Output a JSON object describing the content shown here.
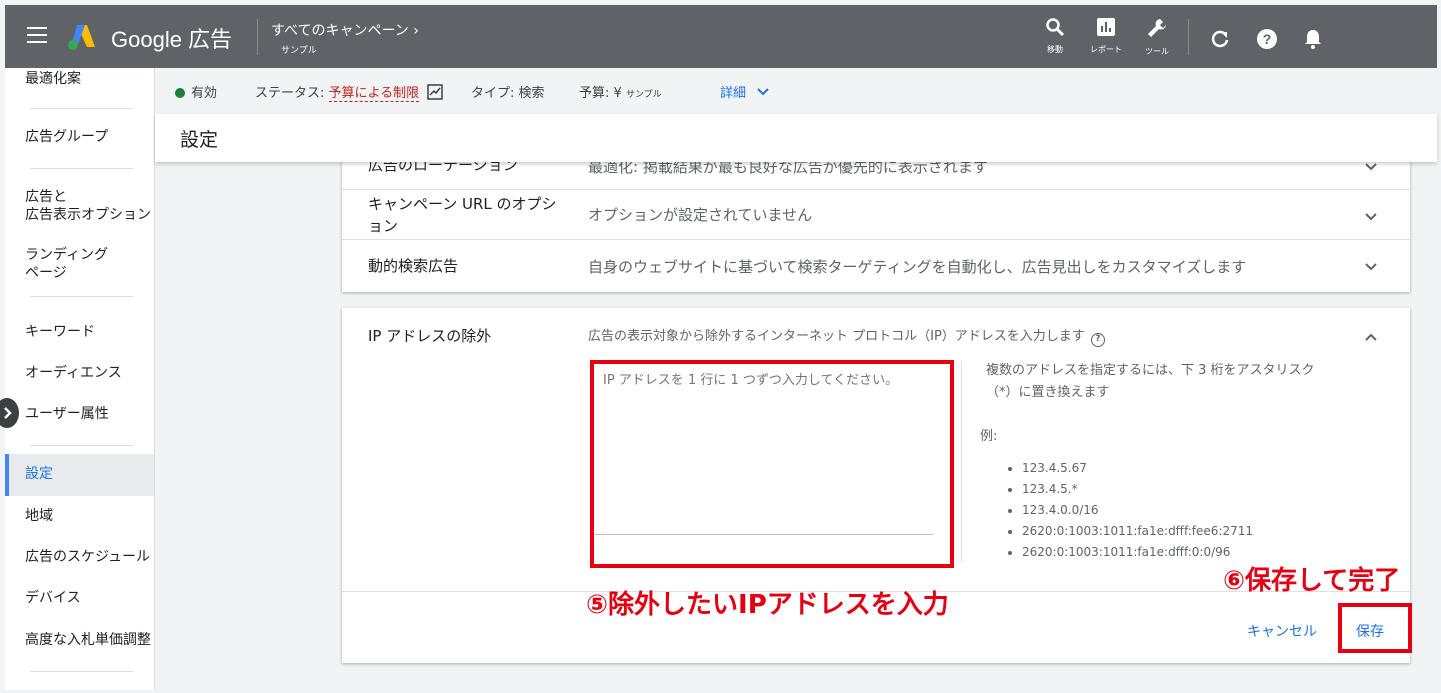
{
  "topbar": {
    "menu_icon": "hamburger-icon",
    "logo_text": "Google 広告",
    "crumb_title": "すべてのキャンペーン",
    "crumb_sub": "サンプル",
    "actions": [
      {
        "icon": "search-icon",
        "label": "移動"
      },
      {
        "icon": "report-icon",
        "label": "レポート"
      },
      {
        "icon": "wrench-icon",
        "label": "ツール"
      }
    ],
    "refresh_icon": "refresh-icon",
    "help_icon": "help-icon",
    "bell_icon": "bell-icon"
  },
  "sidebar": {
    "items": [
      {
        "label": "最適化案"
      },
      {
        "label": "広告グループ"
      },
      {
        "label": "広告と\n広告表示オプション"
      },
      {
        "label": "ランディング\nページ"
      },
      {
        "label": "キーワード"
      },
      {
        "label": "オーディエンス"
      },
      {
        "label": "ユーザー属性"
      },
      {
        "label": "設定"
      },
      {
        "label": "地域"
      },
      {
        "label": "広告のスケジュール"
      },
      {
        "label": "デバイス"
      },
      {
        "label": "高度な入札単価調整"
      }
    ],
    "active_index": 7
  },
  "status": {
    "enabled_label": "有効",
    "status_prefix": "ステータス:",
    "status_value": "予算による制限",
    "type_prefix": "タイプ:",
    "type_value": "検索",
    "budget_prefix": "予算: ¥",
    "budget_value": "サンプル",
    "details_label": "詳細"
  },
  "settings": {
    "title": "設定"
  },
  "card1": {
    "rows": [
      {
        "label": "広告のローテーション",
        "value": "最適化: 掲載結果が最も良好な広告が優先的に表示されます"
      },
      {
        "label": "キャンペーン URL のオプション",
        "value": "オプションが設定されていません"
      },
      {
        "label": "動的検索広告",
        "value": "自身のウェブサイトに基づいて検索ターゲティングを自動化し、広告見出しをカスタマイズします"
      }
    ]
  },
  "ip_section": {
    "label": "IP アドレスの除外",
    "description": "広告の表示対象から除外するインターネット プロトコル（IP）アドレスを入力します",
    "placeholder": "IP アドレスを 1 行に 1 つずつ入力してください。",
    "hint_line1": "複数のアドレスを指定するには、下 3 桁をアスタリスク",
    "hint_line2": "（*）に置き換えます",
    "example_label": "例:",
    "examples": [
      "123.4.5.67",
      "123.4.5.*",
      "123.4.0.0/16",
      "2620:0:1003:1011:fa1e:dfff:fee6:2711",
      "2620:0:1003:1011:fa1e:dfff:0:0/96"
    ],
    "cancel_label": "キャンセル",
    "save_label": "保存"
  },
  "annotations": {
    "step5": "⑤除外したいIPアドレスを入力",
    "step6": "⑥保存して完了",
    "color": "#e60012"
  },
  "colors": {
    "topbar": "#5f6368",
    "accent": "#1a73e8",
    "status_red": "#c5221f",
    "status_green": "#188038"
  }
}
